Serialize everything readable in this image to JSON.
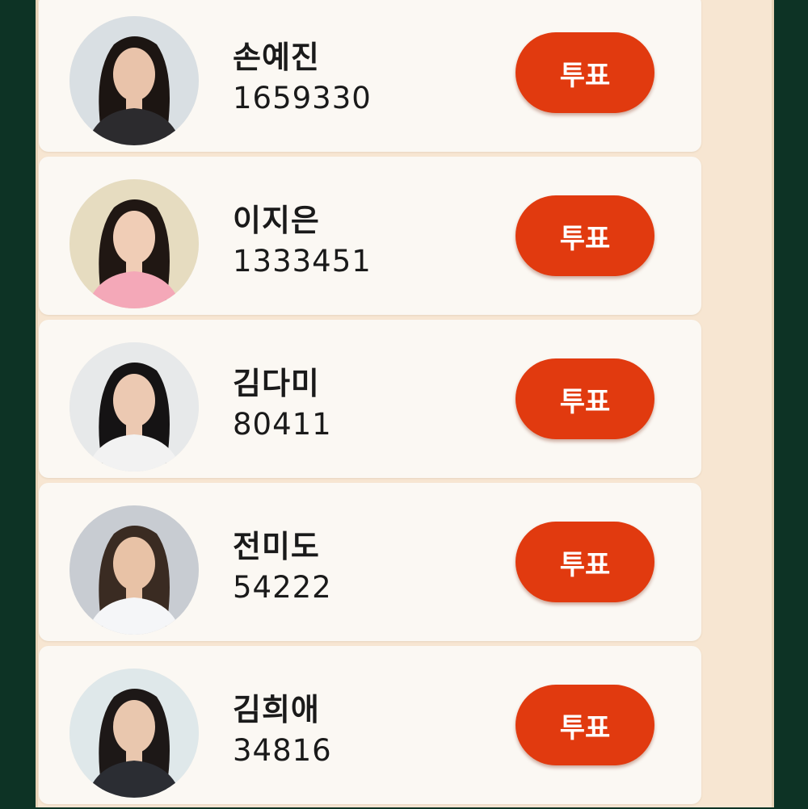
{
  "candidates": [
    {
      "name": "손예진",
      "votes": "1659330",
      "vote_label": "투표",
      "photo_bg": "#d9dfe3",
      "hair": "#1c1512",
      "skin": "#e9c3aa",
      "top": "#2c2b2e"
    },
    {
      "name": "이지은",
      "votes": "1333451",
      "vote_label": "투표",
      "photo_bg": "#e6dcc0",
      "hair": "#201713",
      "skin": "#f0cdb6",
      "top": "#f4a8b8"
    },
    {
      "name": "김다미",
      "votes": "80411",
      "vote_label": "투표",
      "photo_bg": "#e7e9ea",
      "hair": "#151314",
      "skin": "#ecc9b2",
      "top": "#f2f2f2"
    },
    {
      "name": "전미도",
      "votes": "54222",
      "vote_label": "투표",
      "photo_bg": "#c8ccd2",
      "hair": "#3a2b22",
      "skin": "#e8c2a6",
      "top": "#f5f6f8"
    },
    {
      "name": "김희애",
      "votes": "34816",
      "vote_label": "투표",
      "photo_bg": "#dfe8ea",
      "hair": "#1d1817",
      "skin": "#e9c7ae",
      "top": "#2b2d33"
    }
  ],
  "colors": {
    "accent": "#e13a0f",
    "frame": "#f7e6d2",
    "outer": "#0d3325"
  }
}
